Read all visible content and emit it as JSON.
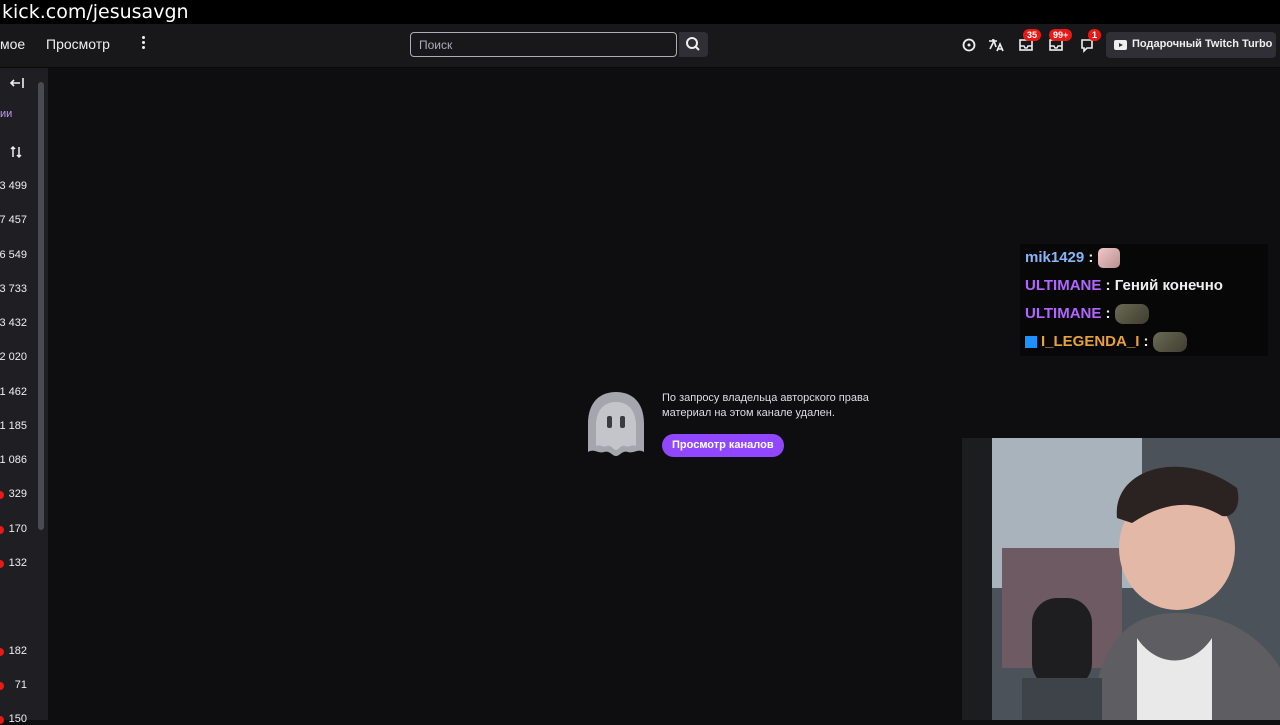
{
  "url_overlay": "kick.com/jesusavgn",
  "nav": {
    "link_following": "мое",
    "link_browse": "Просмотр",
    "search_placeholder": "Поиск",
    "badges": {
      "inbox": "35",
      "whispers": "99+",
      "notifications": "1"
    },
    "turbo_label": "Подарочный Twitch Turbo"
  },
  "sidebar": {
    "section_label": "ии",
    "viewer_counts": [
      "3 499",
      "7 457",
      "6 549",
      "3 733",
      "3 432",
      "2 020",
      "1 462",
      "1 185",
      "1 086",
      "329",
      "170",
      "132",
      "182",
      "71",
      "150"
    ]
  },
  "main": {
    "message": "По запросу владельца авторского права материал на этом канале удален.",
    "button_label": "Просмотр каналов"
  },
  "chat": [
    {
      "user": "mik1429",
      "color": "#8ab4f8",
      "text": "",
      "emote": "cat"
    },
    {
      "user": "ULTIMANE",
      "color": "#b366ff",
      "text": "Гений конечно",
      "emote": ""
    },
    {
      "user": "ULTIMANE",
      "color": "#b366ff",
      "text": "",
      "emote": "frog"
    },
    {
      "user": "I_LEGENDA_I",
      "color": "#e8a23c",
      "text": "",
      "emote": "frog",
      "badge": true
    }
  ],
  "colors": {
    "accent": "#9147ff",
    "badge_red": "#e91916",
    "bg": "#0e0e10"
  }
}
